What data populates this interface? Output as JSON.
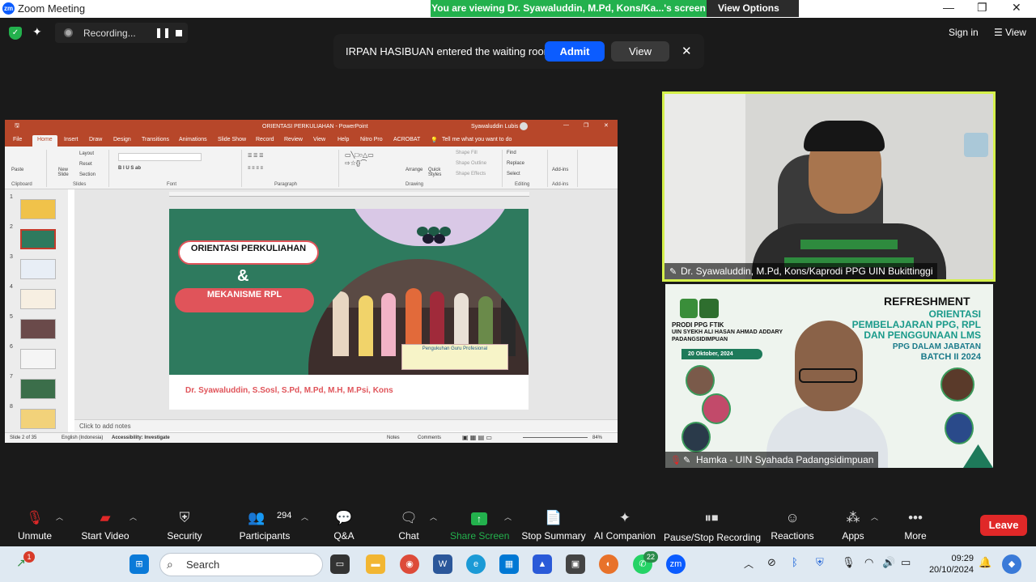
{
  "window": {
    "app_icon": "zm",
    "title": "Zoom Meeting"
  },
  "banner": {
    "message": "You are viewing Dr. Syawaluddin, M.Pd, Kons/Ka...'s screen",
    "view_options": "View Options"
  },
  "recording": {
    "label": "Recording..."
  },
  "top_right": {
    "signin": "Sign in",
    "view": "View"
  },
  "waiting_room": {
    "message": "IRPAN HASIBUAN entered the waiting room",
    "admit": "Admit",
    "view": "View"
  },
  "ppt": {
    "title": "ORIENTASI PERKULIAHAN  -  PowerPoint",
    "user": "Syawaluddin Lubis",
    "tabs": [
      "File",
      "Home",
      "Insert",
      "Draw",
      "Design",
      "Transitions",
      "Animations",
      "Slide Show",
      "Record",
      "Review",
      "View",
      "Help",
      "Nitro Pro",
      "ACROBAT"
    ],
    "tell_me": "Tell me what you want to do",
    "groups": [
      "Clipboard",
      "Slides",
      "Font",
      "Paragraph",
      "Drawing",
      "Editing",
      "Add-ins"
    ],
    "ribbon": {
      "paste": "Paste",
      "new_slide": "New Slide",
      "layout": "Layout",
      "reset": "Reset",
      "section": "Section",
      "arrange": "Arrange",
      "quick_styles": "Quick Styles",
      "shape_fill": "Shape Fill",
      "shape_outline": "Shape Outline",
      "shape_effects": "Shape Effects",
      "find": "Find",
      "replace": "Replace",
      "select": "Select",
      "addins": "Add-ins"
    },
    "slide_numbers": [
      "1",
      "2",
      "3",
      "4",
      "5",
      "6",
      "7",
      "8"
    ],
    "slide": {
      "pill1": "ORIENTASI PERKULIAHAN",
      "amp": "&",
      "pill2": "MEKANISME RPL",
      "author": "Dr. Syawaluddin, S.Sosl, S.Pd, M.Pd, M.H, M.Psi, Kons",
      "banner_text": "Pengukuhan Guru Profesional"
    },
    "notes": "Click to add notes",
    "status": {
      "slide": "Slide 2 of 35",
      "language": "English (Indonesia)",
      "accessibility": "Accessibility: Investigate",
      "notes": "Notes",
      "comments": "Comments",
      "zoom": "84%"
    }
  },
  "tiles": [
    {
      "name": "Dr. Syawaluddin, M.Pd, Kons/Kaprodi PPG UIN Bukittinggi"
    },
    {
      "name": "Hamka - UIN Syahada Padangsidimpuan",
      "poster": {
        "title": "REFRESHMENT",
        "line1": "ORIENTASI",
        "line2": "PEMBELAJARAN PPG, RPL",
        "line3": "DAN PENGGUNAAN LMS",
        "line4": "PPG DALAM JABATAN",
        "line5": "BATCH II 2024",
        "prodi": "PRODI PPG FTIK",
        "univ": "UIN SYEKH ALI HASAN AHMAD ADDARY PADANGSIDIMPUAN",
        "date": "20 Oktober, 2024"
      }
    }
  ],
  "toolbar": {
    "buttons": [
      {
        "label": "Unmute",
        "icon": "mic-off-icon"
      },
      {
        "label": "Start Video",
        "icon": "video-off-icon"
      },
      {
        "label": "Security",
        "icon": "shield-icon"
      },
      {
        "label": "Participants",
        "icon": "people-icon",
        "count": "294"
      },
      {
        "label": "Q&A",
        "icon": "qa-icon"
      },
      {
        "label": "Chat",
        "icon": "chat-icon"
      },
      {
        "label": "Share Screen",
        "icon": "share-icon"
      },
      {
        "label": "Stop Summary",
        "icon": "summary-icon"
      },
      {
        "label": "AI Companion",
        "icon": "sparkle-icon"
      },
      {
        "label": "Pause/Stop Recording",
        "icon": "record-icon"
      },
      {
        "label": "Reactions",
        "icon": "smile-icon"
      },
      {
        "label": "Apps",
        "icon": "apps-icon"
      },
      {
        "label": "More",
        "icon": "more-icon"
      }
    ],
    "leave": "Leave"
  },
  "taskbar": {
    "search": "Search",
    "time": "09:29",
    "date": "20/10/2024",
    "whatsapp_badge": "22",
    "notif_badge": "1"
  },
  "colors": {
    "share_green": "#23b14d",
    "zoom_blue": "#0b5cff",
    "leave_red": "#e02828",
    "ppt_red": "#b7472a",
    "speaker_border": "#d5f04a"
  }
}
